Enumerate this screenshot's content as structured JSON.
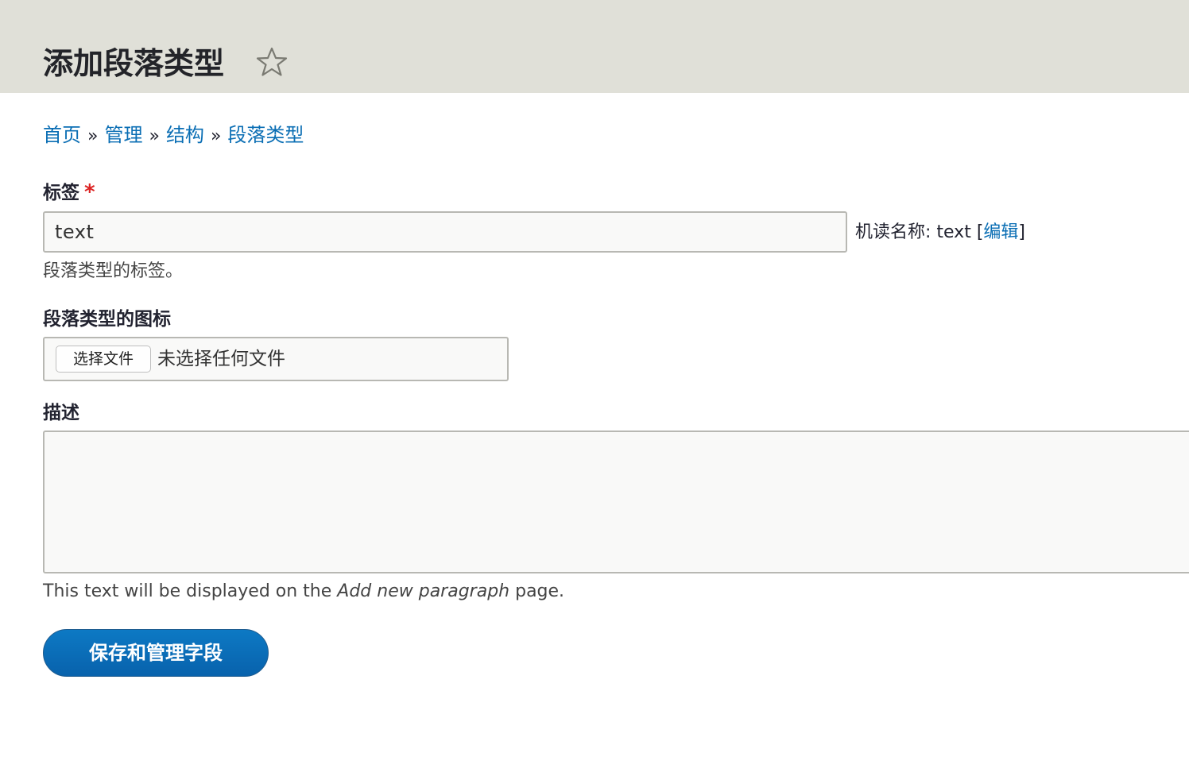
{
  "header": {
    "title": "添加段落类型"
  },
  "breadcrumb": {
    "items": [
      "首页",
      "管理",
      "结构",
      "段落类型"
    ],
    "separator": "»"
  },
  "form": {
    "label_field": {
      "label": "标签",
      "required_mark": "*",
      "value": "text",
      "machine_name_prefix": "机读名称: text [",
      "machine_name_edit": "编辑",
      "machine_name_suffix": "]",
      "help": "段落类型的标签。"
    },
    "icon_field": {
      "label": "段落类型的图标",
      "button_label": "选择文件",
      "status": "未选择任何文件"
    },
    "description_field": {
      "label": "描述",
      "value": "",
      "help_prefix": "This text will be displayed on the ",
      "help_emphasis": "Add new paragraph",
      "help_suffix": " page."
    },
    "submit_label": "保存和管理字段"
  },
  "colors": {
    "header_bg": "#e0e0d8",
    "link": "#0a6eb4",
    "required": "#dc2323",
    "primary_button": "#0a6eb4"
  }
}
